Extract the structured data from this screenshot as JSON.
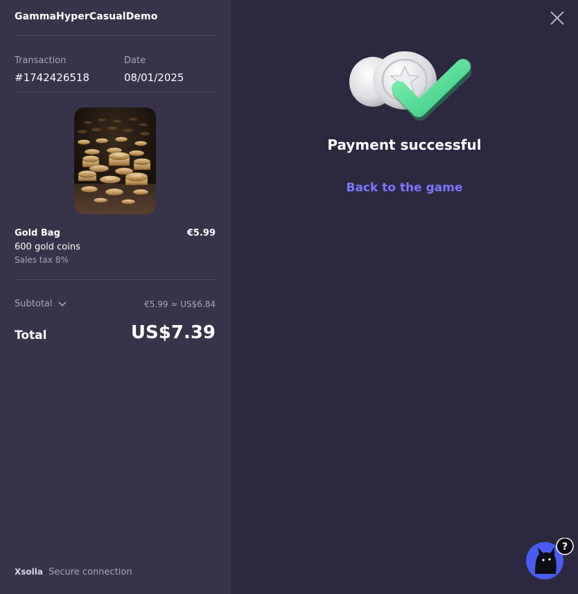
{
  "app": {
    "title": "GammaHyperCasualDemo"
  },
  "transaction": {
    "label": "Transaction",
    "value": "#1742426518",
    "date_label": "Date",
    "date_value": "08/01/2025"
  },
  "item": {
    "name": "Gold Bag",
    "price": "€5.99",
    "description": "600 gold coins",
    "tax": "Sales tax 8%"
  },
  "summary": {
    "subtotal_label": "Subtotal",
    "subtotal_amount": "€5.99 ≈ US$6.84",
    "total_label": "Total",
    "total_amount": "US$7.39"
  },
  "footer": {
    "brand": "Xsolla",
    "text": "Secure connection"
  },
  "status": {
    "title": "Payment successful",
    "back_link": "Back to the game"
  },
  "help": {
    "badge": "?"
  },
  "colors": {
    "sidebar_bg": "#37334a",
    "main_bg": "#2c2840",
    "link": "#7c77ff",
    "check": "#5de39d",
    "help_bg": "#4a5cf0"
  },
  "icons": {
    "close": "close-icon",
    "chevron": "chevron-down-icon",
    "success": "payment-success-icon",
    "help": "support-cat-icon"
  }
}
